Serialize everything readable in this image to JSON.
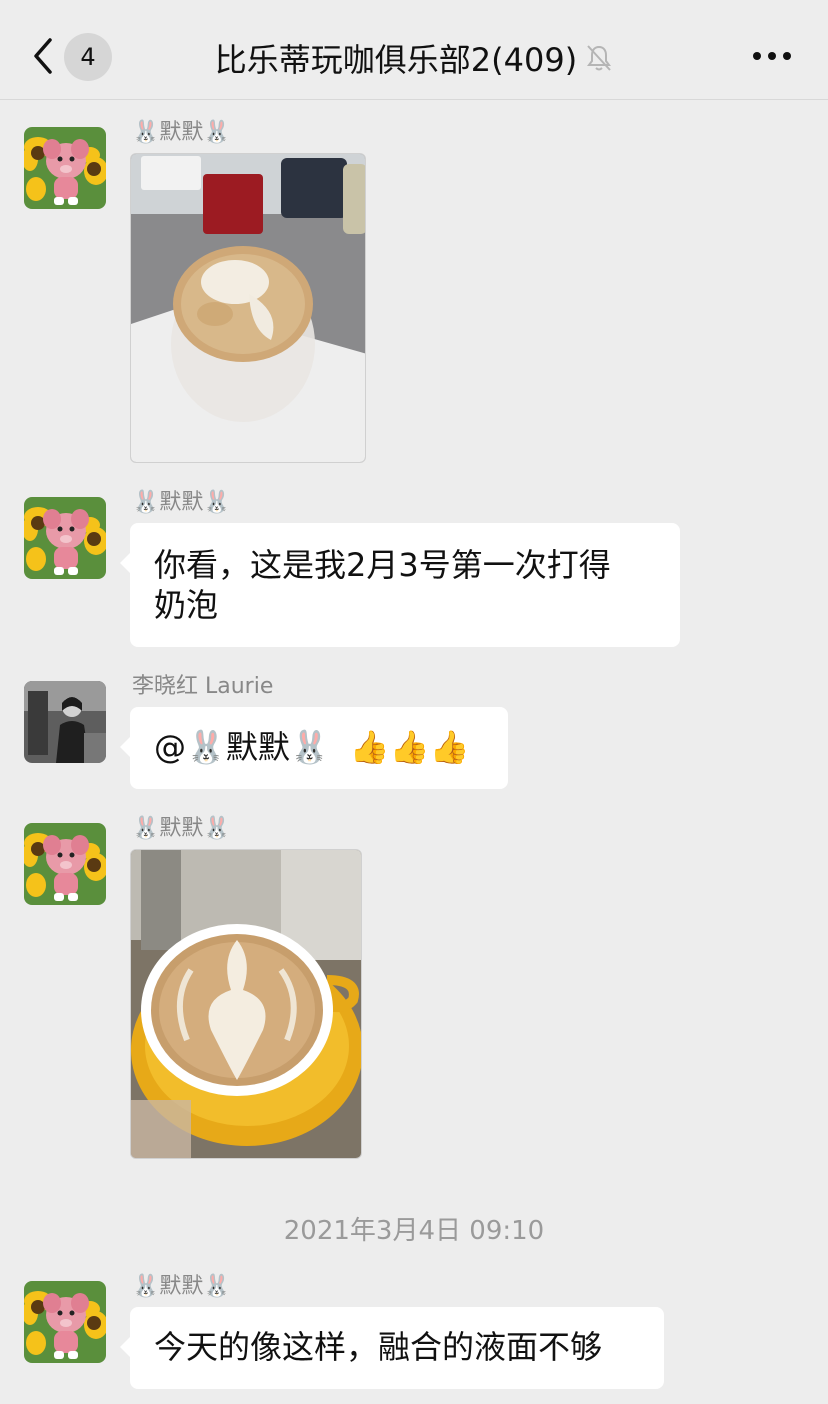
{
  "header": {
    "unread_count": "4",
    "title": "比乐蒂玩咖俱乐部2(409)"
  },
  "messages": [
    {
      "sender": "🐰默默🐰",
      "type": "image"
    },
    {
      "sender": "🐰默默🐰",
      "type": "text",
      "line1": "你看，这是我2月3号第一次打得",
      "line2": "奶泡"
    },
    {
      "sender": "李晓红 Laurie",
      "type": "text",
      "mention": "@🐰默默🐰",
      "emoji": "👍👍👍"
    },
    {
      "sender": "🐰默默🐰",
      "type": "image"
    },
    {
      "sender": "🐰默默🐰",
      "type": "text",
      "text": "今天的像这样，融合的液面不够"
    }
  ],
  "timestamp": "2021年3月4日 09:10",
  "colors": {
    "background": "#ededed",
    "bubble": "#ffffff",
    "sender_text": "#888888",
    "timestamp_text": "#9a9a9a"
  },
  "icons": {
    "back": "chevron-left-icon",
    "mute": "bell-slash-icon",
    "more": "more-dots-icon"
  }
}
